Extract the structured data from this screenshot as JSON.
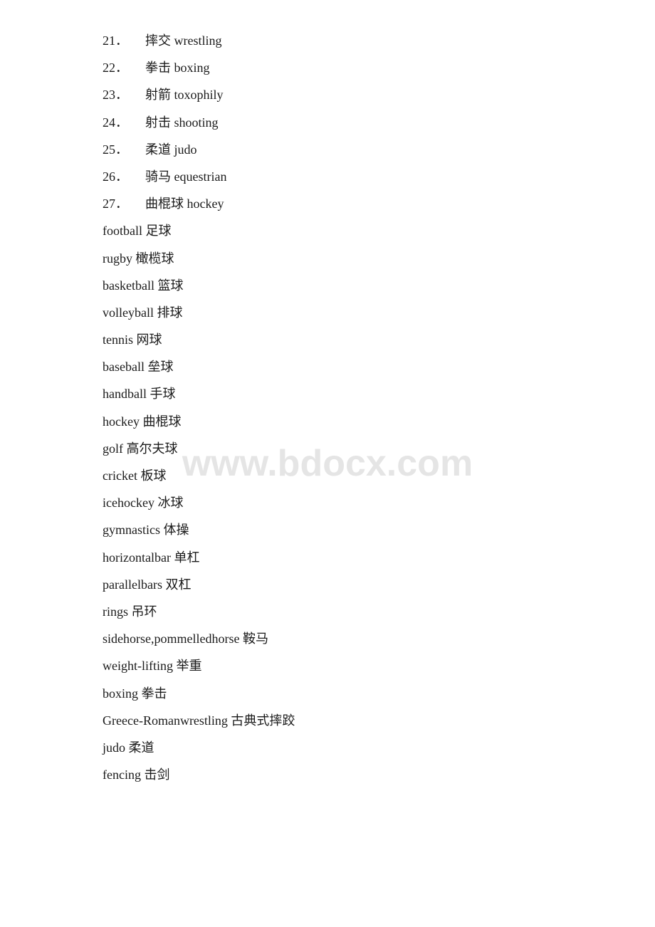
{
  "watermark": "www.bdocx.com",
  "numbered_items": [
    {
      "number": "21．",
      "text": "摔交 wrestling"
    },
    {
      "number": "22．",
      "text": "拳击 boxing"
    },
    {
      "number": "23．",
      "text": "射箭 toxophily"
    },
    {
      "number": "24．",
      "text": "射击 shooting"
    },
    {
      "number": "25．",
      "text": "柔道 judo"
    },
    {
      "number": "26．",
      "text": "骑马 equestrian"
    },
    {
      "number": "27．",
      "text": "曲棍球 hockey"
    }
  ],
  "plain_items": [
    "football 足球",
    "rugby 橄榄球",
    "basketball 篮球",
    "volleyball 排球",
    "tennis 网球",
    "baseball 垒球",
    "handball 手球",
    "hockey 曲棍球",
    "golf 高尔夫球",
    "cricket 板球",
    "icehockey 冰球",
    "gymnastics 体操",
    "horizontalbar 单杠",
    "parallelbars 双杠",
    "rings 吊环",
    "sidehorse,pommelledhorse 鞍马",
    "weight-lifting 举重",
    "boxing 拳击",
    "Greece-Romanwrestling 古典式摔跤",
    "judo 柔道",
    "fencing 击剑"
  ]
}
